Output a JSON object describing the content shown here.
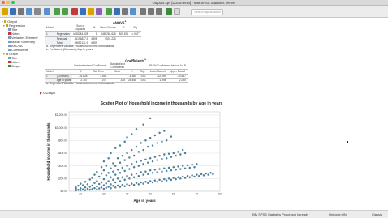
{
  "window": {
    "title": "Output4.spv [Document4] - IBM SPSS Statistics Viewer"
  },
  "toolbar": {
    "search_placeholder": "Search application"
  },
  "outline": {
    "items": [
      {
        "label": "Output",
        "level": 0,
        "key": "output"
      },
      {
        "label": "Regression",
        "level": 1,
        "key": "regression"
      },
      {
        "label": "Title",
        "level": 2,
        "key": "title"
      },
      {
        "label": "Notes",
        "level": 2,
        "key": "notes"
      },
      {
        "label": "Variables Entered/",
        "level": 2,
        "key": "variables-entered"
      },
      {
        "label": "Model Summary",
        "level": 2,
        "key": "model-summary"
      },
      {
        "label": "ANOVA",
        "level": 2,
        "key": "anova"
      },
      {
        "label": "Coefficients",
        "level": 2,
        "key": "coefficients"
      },
      {
        "label": "Graph",
        "level": 1,
        "key": "graph"
      },
      {
        "label": "Title",
        "level": 2,
        "key": "graph-title"
      },
      {
        "label": "Notes",
        "level": 2,
        "key": "graph-notes"
      },
      {
        "label": "Graph",
        "level": 2,
        "key": "graph-graph"
      }
    ]
  },
  "anova": {
    "caption": "ANOVA",
    "caption_sup": "a",
    "headers": [
      "Model",
      "",
      "Sum of Squares",
      "df",
      "Mean Square",
      "F",
      "Sig."
    ],
    "rows": [
      [
        "1",
        "Regression",
        "4455284.628",
        "1",
        "4455284.628",
        "809.871",
        "<.001"
      ],
      [
        "",
        "Residual",
        "35196837.3",
        "6398",
        "5501.225",
        "",
        ""
      ],
      [
        "",
        "Total",
        "39652121.9",
        "6399",
        "",
        "",
        ""
      ]
    ],
    "sig_sup": "b",
    "notes": [
      "a. Dependent Variable:  Household income in thousands",
      "b. Predictors: (Constant), Age in years"
    ]
  },
  "coefficients": {
    "caption": "Coefficients",
    "caption_sup": "a",
    "group_headers": [
      "Unstandardized Coefficients",
      "Standardized Coefficients",
      "95.0% Confidence Interval for B"
    ],
    "headers": [
      "Model",
      "",
      "B",
      "Std. Error",
      "Beta",
      "t",
      "Sig.",
      "Lower Bound",
      "Upper Bound"
    ],
    "rows": [
      [
        "1",
        "(Constant)",
        "-16.628",
        "3.098",
        "",
        "-5.360",
        "<.001",
        "-22.699",
        "-10.547"
      ],
      [
        "",
        "Age in years",
        "2.147",
        ".075",
        ".335",
        "28.458",
        "<.001",
        "1.998",
        "2.295"
      ]
    ],
    "notes": [
      "a. Dependent Variable:  Household income in thousands"
    ]
  },
  "graph_section": {
    "label": "GGraph"
  },
  "chart_data": {
    "type": "scatter",
    "title": "Scatter Plot of Household income in thousands by Age in years",
    "xlabel": "Age in years",
    "ylabel": "Household income in thousands",
    "xlim": [
      15,
      80
    ],
    "ylim": [
      0,
      1250
    ],
    "xticks": [
      20,
      30,
      40,
      50,
      60,
      70,
      80
    ],
    "yticks": [
      "$0.00",
      "$200.00",
      "$400.00",
      "$600.00",
      "$800.00",
      "$1,000.00",
      "$1,200.00"
    ],
    "ytick_values": [
      0,
      200,
      400,
      600,
      800,
      1000,
      1200
    ],
    "grid": true,
    "marker_color": "#2e6e8e",
    "points": [
      [
        18,
        12
      ],
      [
        18,
        35
      ],
      [
        18,
        60
      ],
      [
        19,
        22
      ],
      [
        19,
        88
      ],
      [
        20,
        15
      ],
      [
        20,
        48
      ],
      [
        20,
        120
      ],
      [
        21,
        30
      ],
      [
        21,
        95
      ],
      [
        22,
        18
      ],
      [
        22,
        62
      ],
      [
        22,
        150
      ],
      [
        23,
        40
      ],
      [
        23,
        110
      ],
      [
        24,
        25
      ],
      [
        24,
        70
      ],
      [
        24,
        185
      ],
      [
        25,
        35
      ],
      [
        25,
        90
      ],
      [
        25,
        210
      ],
      [
        26,
        50
      ],
      [
        26,
        130
      ],
      [
        26,
        260
      ],
      [
        27,
        28
      ],
      [
        27,
        75
      ],
      [
        27,
        160
      ],
      [
        27,
        305
      ],
      [
        28,
        45
      ],
      [
        28,
        115
      ],
      [
        28,
        230
      ],
      [
        29,
        60
      ],
      [
        29,
        140
      ],
      [
        29,
        280
      ],
      [
        29,
        380
      ],
      [
        30,
        38
      ],
      [
        30,
        95
      ],
      [
        30,
        190
      ],
      [
        30,
        330
      ],
      [
        30,
        470
      ],
      [
        31,
        55
      ],
      [
        31,
        125
      ],
      [
        31,
        250
      ],
      [
        31,
        400
      ],
      [
        32,
        70
      ],
      [
        32,
        160
      ],
      [
        32,
        290
      ],
      [
        32,
        520
      ],
      [
        33,
        48
      ],
      [
        33,
        110
      ],
      [
        33,
        220
      ],
      [
        33,
        360
      ],
      [
        33,
        600
      ],
      [
        34,
        85
      ],
      [
        34,
        180
      ],
      [
        34,
        310
      ],
      [
        34,
        440
      ],
      [
        35,
        60
      ],
      [
        35,
        140
      ],
      [
        35,
        260
      ],
      [
        35,
        400
      ],
      [
        35,
        680
      ],
      [
        36,
        90
      ],
      [
        36,
        200
      ],
      [
        36,
        340
      ],
      [
        36,
        520
      ],
      [
        37,
        70
      ],
      [
        37,
        160
      ],
      [
        37,
        290
      ],
      [
        37,
        450
      ],
      [
        37,
        720
      ],
      [
        38,
        100
      ],
      [
        38,
        220
      ],
      [
        38,
        370
      ],
      [
        38,
        560
      ],
      [
        39,
        80
      ],
      [
        39,
        180
      ],
      [
        39,
        320
      ],
      [
        39,
        490
      ],
      [
        39,
        780
      ],
      [
        40,
        110
      ],
      [
        40,
        240
      ],
      [
        40,
        400
      ],
      [
        40,
        600
      ],
      [
        40,
        850
      ],
      [
        41,
        90
      ],
      [
        41,
        200
      ],
      [
        41,
        350
      ],
      [
        41,
        530
      ],
      [
        42,
        120
      ],
      [
        42,
        260
      ],
      [
        42,
        430
      ],
      [
        42,
        650
      ],
      [
        42,
        900
      ],
      [
        43,
        100
      ],
      [
        43,
        220
      ],
      [
        43,
        380
      ],
      [
        43,
        560
      ],
      [
        44,
        130
      ],
      [
        44,
        280
      ],
      [
        44,
        460
      ],
      [
        44,
        700
      ],
      [
        44,
        980
      ],
      [
        45,
        110
      ],
      [
        45,
        240
      ],
      [
        45,
        400
      ],
      [
        45,
        620
      ],
      [
        46,
        140
      ],
      [
        46,
        300
      ],
      [
        46,
        480
      ],
      [
        46,
        760
      ],
      [
        47,
        120
      ],
      [
        47,
        260
      ],
      [
        47,
        430
      ],
      [
        47,
        650
      ],
      [
        47,
        1050
      ],
      [
        48,
        150
      ],
      [
        48,
        310
      ],
      [
        48,
        500
      ],
      [
        48,
        800
      ],
      [
        49,
        130
      ],
      [
        49,
        270
      ],
      [
        49,
        450
      ],
      [
        49,
        700
      ],
      [
        50,
        160
      ],
      [
        50,
        330
      ],
      [
        50,
        520
      ],
      [
        50,
        840
      ],
      [
        50,
        1150
      ],
      [
        51,
        140
      ],
      [
        51,
        290
      ],
      [
        51,
        470
      ],
      [
        51,
        720
      ],
      [
        52,
        170
      ],
      [
        52,
        340
      ],
      [
        52,
        540
      ],
      [
        52,
        880
      ],
      [
        53,
        150
      ],
      [
        53,
        300
      ],
      [
        53,
        490
      ],
      [
        53,
        760
      ],
      [
        54,
        180
      ],
      [
        54,
        350
      ],
      [
        54,
        560
      ],
      [
        54,
        920
      ],
      [
        55,
        160
      ],
      [
        55,
        310
      ],
      [
        55,
        510
      ],
      [
        55,
        780
      ],
      [
        56,
        190
      ],
      [
        56,
        360
      ],
      [
        56,
        580
      ],
      [
        56,
        950
      ],
      [
        57,
        170
      ],
      [
        57,
        320
      ],
      [
        57,
        520
      ],
      [
        57,
        800
      ],
      [
        58,
        200
      ],
      [
        58,
        370
      ],
      [
        58,
        590
      ],
      [
        59,
        180
      ],
      [
        59,
        330
      ],
      [
        59,
        540
      ],
      [
        59,
        860
      ],
      [
        60,
        210
      ],
      [
        60,
        380
      ],
      [
        60,
        600
      ],
      [
        61,
        190
      ],
      [
        61,
        340
      ],
      [
        61,
        560
      ],
      [
        62,
        220
      ],
      [
        62,
        390
      ],
      [
        62,
        620
      ],
      [
        63,
        200
      ],
      [
        63,
        350
      ],
      [
        63,
        580
      ],
      [
        64,
        230
      ],
      [
        64,
        400
      ],
      [
        64,
        650
      ],
      [
        65,
        210
      ],
      [
        65,
        360
      ],
      [
        65,
        600
      ],
      [
        66,
        240
      ],
      [
        66,
        410
      ],
      [
        67,
        220
      ],
      [
        67,
        370
      ],
      [
        68,
        250
      ],
      [
        68,
        420
      ],
      [
        69,
        230
      ],
      [
        69,
        380
      ],
      [
        70,
        260
      ],
      [
        70,
        430
      ],
      [
        71,
        240
      ],
      [
        72,
        270
      ],
      [
        73,
        250
      ],
      [
        74,
        280
      ],
      [
        75,
        260
      ],
      [
        76,
        290
      ],
      [
        77,
        270
      ]
    ]
  },
  "status": {
    "processor": "IBM SPSS Statistics Processor is ready",
    "encoding": "Unicode:ON",
    "mode": "Classic"
  }
}
